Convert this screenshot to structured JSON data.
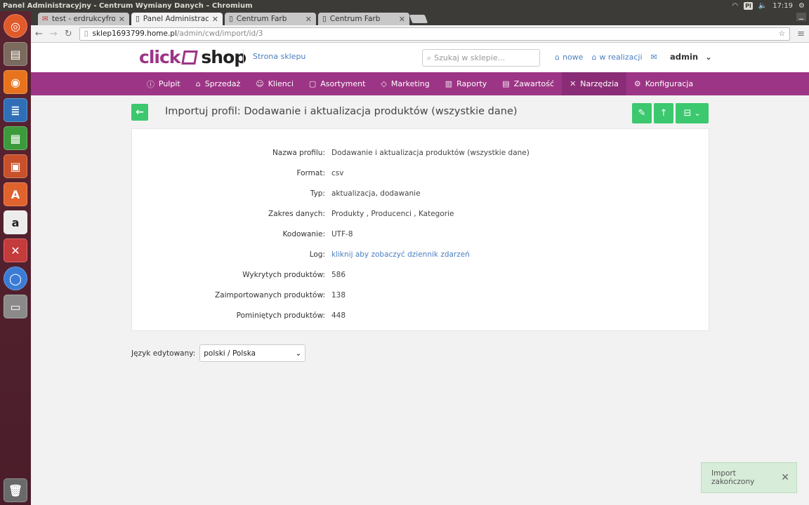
{
  "os_panel": {
    "title": "Panel Administracyjny - Centrum Wymiany Danych – Chromium",
    "keyboard": "Pl",
    "time": "17:19"
  },
  "browser": {
    "tabs": [
      {
        "label": "test - erdrukcyfrow"
      },
      {
        "label": "Panel Administracy"
      },
      {
        "label": "Centrum Farb"
      },
      {
        "label": "Centrum Farb"
      }
    ],
    "url_host": "sklep1693799.home.pl",
    "url_path": "/admin/cwd/import/id/3"
  },
  "header": {
    "logo_left": "click",
    "logo_right": "shop",
    "store_link": "Strona sklepu",
    "search_placeholder": "Szukaj w sklepie...",
    "links": [
      "nowe",
      "w realizacji"
    ],
    "user": "admin"
  },
  "nav": {
    "items": [
      "Pulpit",
      "Sprzedaż",
      "Klienci",
      "Asortyment",
      "Marketing",
      "Raporty",
      "Zawartość",
      "Narzędzia",
      "Konfiguracja"
    ],
    "active": "Narzędzia"
  },
  "page": {
    "title": "Importuj profil: Dodawanie i aktualizacja produktów (wszystkie dane)",
    "details": [
      {
        "label": "Nazwa profilu:",
        "value": "Dodawanie i aktualizacja produktów (wszystkie dane)"
      },
      {
        "label": "Format:",
        "value": "csv"
      },
      {
        "label": "Typ:",
        "value": "aktualizacja, dodawanie"
      },
      {
        "label": "Zakres danych:",
        "value": "Produkty , Producenci , Kategorie"
      },
      {
        "label": "Kodowanie:",
        "value": "UTF-8"
      },
      {
        "label": "Log:",
        "value": "kliknij aby zobaczyć dziennik zdarzeń"
      },
      {
        "label": "Wykrytych produktów:",
        "value": "586"
      },
      {
        "label": "Zaimportowanych produktów:",
        "value": "138"
      },
      {
        "label": "Pominiętych produktów:",
        "value": "448"
      }
    ],
    "language_label": "Język edytowany:",
    "language_value": "polski / Polska"
  },
  "toast": {
    "message": "Import zakończony"
  },
  "colors": {
    "brand": "#9c3585",
    "action": "#3cc86e",
    "link": "#4a7fc1"
  }
}
